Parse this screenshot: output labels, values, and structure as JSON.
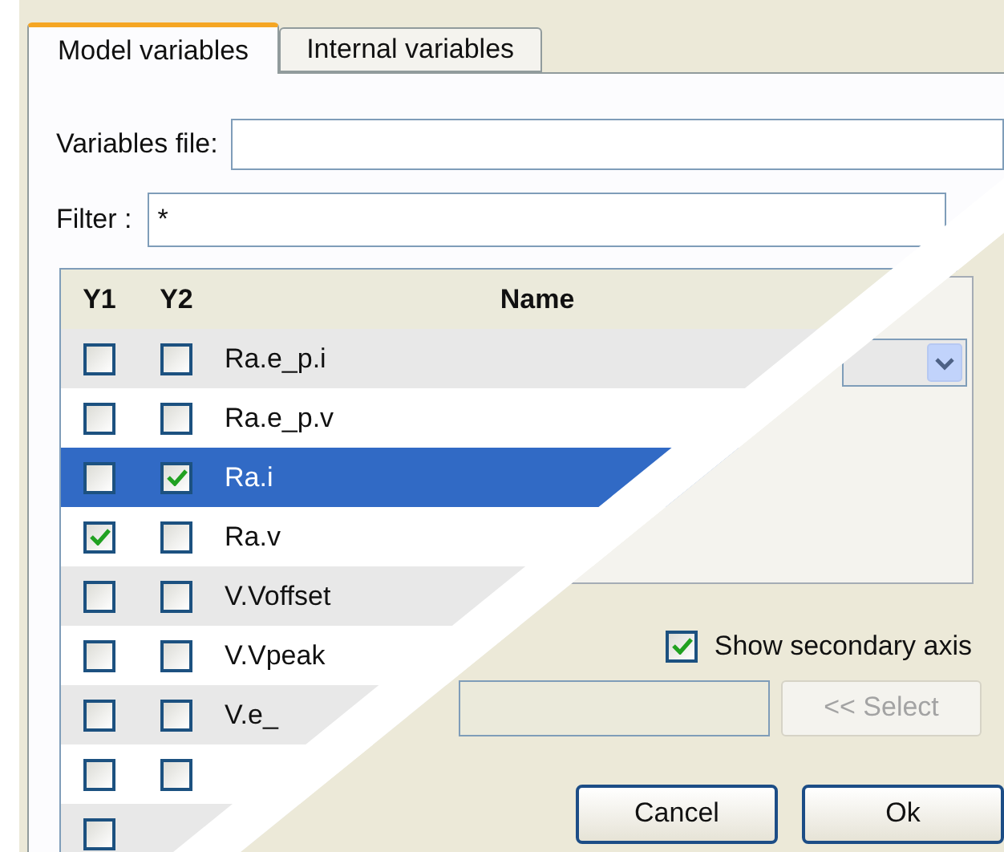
{
  "tabs": [
    {
      "label": "Model variables",
      "selected": true
    },
    {
      "label": "Internal variables",
      "selected": false
    }
  ],
  "variables_file": {
    "label": "Variables file:"
  },
  "filter": {
    "label": "Filter :",
    "value": "*"
  },
  "table": {
    "columns": [
      "Y1",
      "Y2",
      "Name"
    ],
    "rows": [
      {
        "y1": false,
        "y2": false,
        "name": "Ra.e_p.i",
        "selected": false
      },
      {
        "y1": false,
        "y2": false,
        "name": "Ra.e_p.v",
        "selected": false
      },
      {
        "y1": false,
        "y2": true,
        "name": "Ra.i",
        "selected": true
      },
      {
        "y1": true,
        "y2": false,
        "name": "Ra.v",
        "selected": false
      },
      {
        "y1": false,
        "y2": false,
        "name": "V.Voffset",
        "selected": false
      },
      {
        "y1": false,
        "y2": false,
        "name": "V.Vpeak",
        "selected": false
      },
      {
        "y1": false,
        "y2": false,
        "name": "V.e_",
        "selected": false
      },
      {
        "y1": false,
        "y2": false,
        "selected": false
      },
      {
        "y1": false,
        "selected": false
      }
    ]
  },
  "show_secondary_axis": {
    "label": "Show secondary axis",
    "checked": true
  },
  "select_button": {
    "label": "<< Select",
    "disabled": true
  },
  "buttons": [
    "Cancel",
    "Ok"
  ]
}
